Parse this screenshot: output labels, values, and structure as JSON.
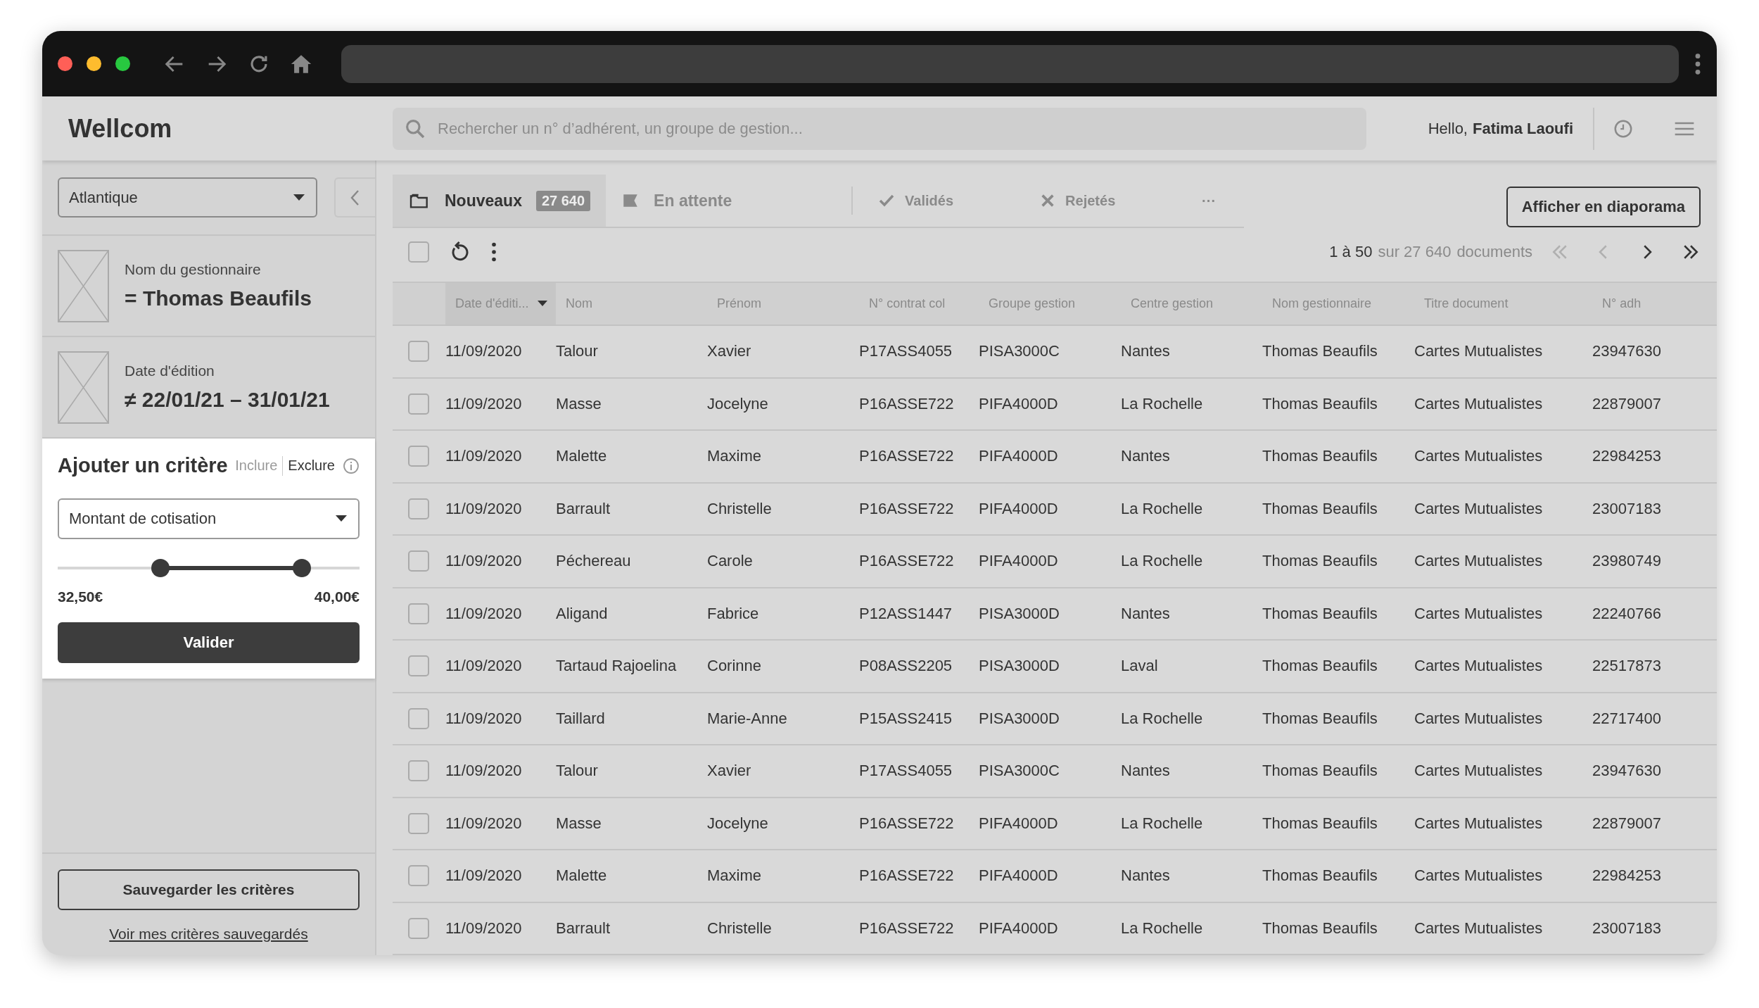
{
  "app": {
    "logo": "Wellcom"
  },
  "search": {
    "placeholder": "Rechercher un n° d’adhérent, un groupe de gestion..."
  },
  "user": {
    "greeting": "Hello,",
    "name": "Fatima Laoufi"
  },
  "sidebar": {
    "region_select": {
      "value": "Atlantique"
    },
    "filters": [
      {
        "label": "Nom du gestionnaire",
        "operator": "=",
        "value": "Thomas Beaufils"
      },
      {
        "label": "Date d'édition",
        "operator": "≠",
        "value": "22/01/21 – 31/01/21"
      }
    ],
    "add_criterion": {
      "title": "Ajouter un critère",
      "modes": [
        {
          "label": "Inclure",
          "selected": false
        },
        {
          "label": "Exclure",
          "selected": true
        }
      ],
      "field_select": {
        "value": "Montant de cotisation"
      },
      "slider": {
        "thumbs": [
          {
            "level": 0.34
          },
          {
            "level": 0.81
          }
        ]
      },
      "min_label": "32,50€",
      "max_label": "40,00€",
      "submit": "Valider"
    },
    "save_button": "Sauvegarder les critères",
    "saved_link": "Voir mes critères sauvegardés"
  },
  "tabs": [
    {
      "label": "Nouveaux",
      "badge": "27 640",
      "selected": true
    },
    {
      "label": "En attente",
      "selected": false
    },
    {
      "label": "Validés",
      "selected": false
    },
    {
      "label": "Rejetés",
      "selected": false
    },
    {
      "label": "···",
      "selected": false
    }
  ],
  "slideshow_button": "Afficher en diaporama",
  "toolbar": {
    "select_all": {
      "checked": false
    }
  },
  "pagination": {
    "range": "1 à 50",
    "total": "sur 27 640",
    "unit": "documents",
    "buttons": [
      {
        "disabled": true
      },
      {
        "disabled": true
      },
      {
        "disabled": false
      },
      {
        "disabled": false
      }
    ]
  },
  "table": {
    "columns": [
      {
        "label": "Date d'éditi...",
        "sorted": true
      },
      {
        "label": "Nom",
        "sorted": false
      },
      {
        "label": "Prénom",
        "sorted": false
      },
      {
        "label": "N° contrat col",
        "sorted": false
      },
      {
        "label": "Groupe gestion",
        "sorted": false
      },
      {
        "label": "Centre gestion",
        "sorted": false
      },
      {
        "label": "Nom gestionnaire",
        "sorted": false
      },
      {
        "label": "Titre document",
        "sorted": false
      },
      {
        "label": "N° adh",
        "sorted": false
      }
    ],
    "rows": [
      {
        "checked": false,
        "cells": [
          "11/09/2020",
          "Talour",
          "Xavier",
          "P17ASS4055",
          "PISA3000C",
          "Nantes",
          "Thomas Beaufils",
          "Cartes Mutualistes",
          "23947630"
        ]
      },
      {
        "checked": false,
        "cells": [
          "11/09/2020",
          "Masse",
          "Jocelyne",
          "P16ASSE722",
          "PIFA4000D",
          "La Rochelle",
          "Thomas Beaufils",
          "Cartes Mutualistes",
          "22879007"
        ]
      },
      {
        "checked": false,
        "cells": [
          "11/09/2020",
          "Malette",
          "Maxime",
          "P16ASSE722",
          "PIFA4000D",
          "Nantes",
          "Thomas Beaufils",
          "Cartes Mutualistes",
          "22984253"
        ]
      },
      {
        "checked": false,
        "cells": [
          "11/09/2020",
          "Barrault",
          "Christelle",
          "P16ASSE722",
          "PIFA4000D",
          "La Rochelle",
          "Thomas Beaufils",
          "Cartes Mutualistes",
          "23007183"
        ]
      },
      {
        "checked": false,
        "cells": [
          "11/09/2020",
          "Péchereau",
          "Carole",
          "P16ASSE722",
          "PIFA4000D",
          "La Rochelle",
          "Thomas Beaufils",
          "Cartes Mutualistes",
          "23980749"
        ]
      },
      {
        "checked": false,
        "cells": [
          "11/09/2020",
          "Aligand",
          "Fabrice",
          "P12ASS1447",
          "PISA3000D",
          "Nantes",
          "Thomas Beaufils",
          "Cartes Mutualistes",
          "22240766"
        ]
      },
      {
        "checked": false,
        "cells": [
          "11/09/2020",
          "Tartaud Rajoelina",
          "Corinne",
          "P08ASS2205",
          "PISA3000D",
          "Laval",
          "Thomas Beaufils",
          "Cartes Mutualistes",
          "22517873"
        ]
      },
      {
        "checked": false,
        "cells": [
          "11/09/2020",
          "Taillard",
          "Marie-Anne",
          "P15ASS2415",
          "PISA3000D",
          "La Rochelle",
          "Thomas Beaufils",
          "Cartes Mutualistes",
          "22717400"
        ]
      },
      {
        "checked": false,
        "cells": [
          "11/09/2020",
          "Talour",
          "Xavier",
          "P17ASS4055",
          "PISA3000C",
          "Nantes",
          "Thomas Beaufils",
          "Cartes Mutualistes",
          "23947630"
        ]
      },
      {
        "checked": false,
        "cells": [
          "11/09/2020",
          "Masse",
          "Jocelyne",
          "P16ASSE722",
          "PIFA4000D",
          "La Rochelle",
          "Thomas Beaufils",
          "Cartes Mutualistes",
          "22879007"
        ]
      },
      {
        "checked": false,
        "cells": [
          "11/09/2020",
          "Malette",
          "Maxime",
          "P16ASSE722",
          "PIFA4000D",
          "Nantes",
          "Thomas Beaufils",
          "Cartes Mutualistes",
          "22984253"
        ]
      },
      {
        "checked": false,
        "cells": [
          "11/09/2020",
          "Barrault",
          "Christelle",
          "P16ASSE722",
          "PIFA4000D",
          "La Rochelle",
          "Thomas Beaufils",
          "Cartes Mutualistes",
          "23007183"
        ]
      }
    ]
  }
}
